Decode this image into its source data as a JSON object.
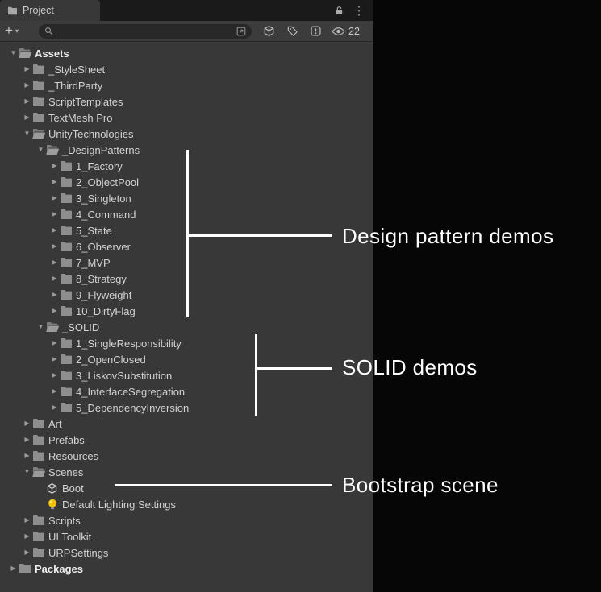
{
  "window": {
    "tab_label": "Project",
    "hidden_count": "22"
  },
  "toolbar": {
    "add_label": "+",
    "search_value": "",
    "search_placeholder": ""
  },
  "icons": {
    "kebab": "⋮",
    "caret": "▾",
    "chevron_expanded": "▼",
    "chevron_collapsed": "▶"
  },
  "tree": {
    "items": [
      {
        "label": "Assets",
        "level": 0,
        "state": "expanded",
        "icon": "folder-open",
        "bold": true
      },
      {
        "label": "_StyleSheet",
        "level": 1,
        "state": "collapsed",
        "icon": "folder",
        "bold": false
      },
      {
        "label": "_ThirdParty",
        "level": 1,
        "state": "collapsed",
        "icon": "folder",
        "bold": false
      },
      {
        "label": "ScriptTemplates",
        "level": 1,
        "state": "collapsed",
        "icon": "folder",
        "bold": false
      },
      {
        "label": "TextMesh Pro",
        "level": 1,
        "state": "collapsed",
        "icon": "folder",
        "bold": false
      },
      {
        "label": "UnityTechnologies",
        "level": 1,
        "state": "expanded",
        "icon": "folder-open",
        "bold": false
      },
      {
        "label": "_DesignPatterns",
        "level": 2,
        "state": "expanded",
        "icon": "folder-open",
        "bold": false
      },
      {
        "label": "1_Factory",
        "level": 3,
        "state": "collapsed",
        "icon": "folder",
        "bold": false
      },
      {
        "label": "2_ObjectPool",
        "level": 3,
        "state": "collapsed",
        "icon": "folder",
        "bold": false
      },
      {
        "label": "3_Singleton",
        "level": 3,
        "state": "collapsed",
        "icon": "folder",
        "bold": false
      },
      {
        "label": "4_Command",
        "level": 3,
        "state": "collapsed",
        "icon": "folder",
        "bold": false
      },
      {
        "label": "5_State",
        "level": 3,
        "state": "collapsed",
        "icon": "folder",
        "bold": false
      },
      {
        "label": "6_Observer",
        "level": 3,
        "state": "collapsed",
        "icon": "folder",
        "bold": false
      },
      {
        "label": "7_MVP",
        "level": 3,
        "state": "collapsed",
        "icon": "folder",
        "bold": false
      },
      {
        "label": "8_Strategy",
        "level": 3,
        "state": "collapsed",
        "icon": "folder",
        "bold": false
      },
      {
        "label": "9_Flyweight",
        "level": 3,
        "state": "collapsed",
        "icon": "folder",
        "bold": false
      },
      {
        "label": "10_DirtyFlag",
        "level": 3,
        "state": "collapsed",
        "icon": "folder",
        "bold": false
      },
      {
        "label": "_SOLID",
        "level": 2,
        "state": "expanded",
        "icon": "folder-open",
        "bold": false
      },
      {
        "label": "1_SingleResponsibility",
        "level": 3,
        "state": "collapsed",
        "icon": "folder",
        "bold": false
      },
      {
        "label": "2_OpenClosed",
        "level": 3,
        "state": "collapsed",
        "icon": "folder",
        "bold": false
      },
      {
        "label": "3_LiskovSubstitution",
        "level": 3,
        "state": "collapsed",
        "icon": "folder",
        "bold": false
      },
      {
        "label": "4_InterfaceSegregation",
        "level": 3,
        "state": "collapsed",
        "icon": "folder",
        "bold": false
      },
      {
        "label": "5_DependencyInversion",
        "level": 3,
        "state": "collapsed",
        "icon": "folder",
        "bold": false
      },
      {
        "label": "Art",
        "level": 1,
        "state": "collapsed",
        "icon": "folder",
        "bold": false
      },
      {
        "label": "Prefabs",
        "level": 1,
        "state": "collapsed",
        "icon": "folder",
        "bold": false
      },
      {
        "label": "Resources",
        "level": 1,
        "state": "collapsed",
        "icon": "folder",
        "bold": false
      },
      {
        "label": "Scenes",
        "level": 1,
        "state": "expanded",
        "icon": "folder-open",
        "bold": false
      },
      {
        "label": "Boot",
        "level": 2,
        "state": "leaf",
        "icon": "scene",
        "bold": false
      },
      {
        "label": "Default Lighting Settings",
        "level": 2,
        "state": "leaf",
        "icon": "lighting",
        "bold": false
      },
      {
        "label": "Scripts",
        "level": 1,
        "state": "collapsed",
        "icon": "folder",
        "bold": false
      },
      {
        "label": "UI Toolkit",
        "level": 1,
        "state": "collapsed",
        "icon": "folder",
        "bold": false
      },
      {
        "label": "URPSettings",
        "level": 1,
        "state": "collapsed",
        "icon": "folder",
        "bold": false
      },
      {
        "label": "Packages",
        "level": 0,
        "state": "collapsed",
        "icon": "folder",
        "bold": true
      }
    ]
  },
  "annotations": {
    "design_patterns": "Design pattern demos",
    "solid": "SOLID demos",
    "bootstrap": "Bootstrap scene"
  },
  "colors": {
    "panel_bg": "#383838",
    "tabbar_bg": "#1a1a1a",
    "search_bg": "#282828",
    "text": "#d2d2d2",
    "annotation": "#ffffff",
    "folder": "#8e8e8e",
    "lighting_icon": "#f2c200"
  }
}
